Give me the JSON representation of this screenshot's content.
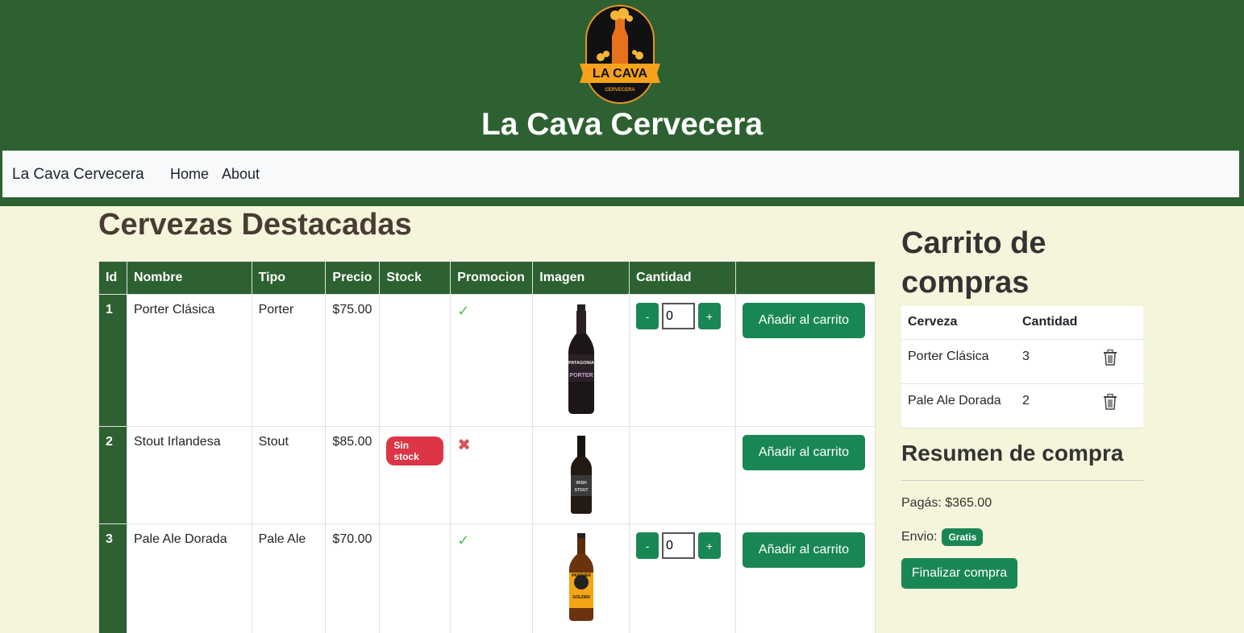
{
  "header": {
    "logo_text": "LA CAVA",
    "logo_subtext": "CERVECERA",
    "title": "La Cava Cervecera"
  },
  "navbar": {
    "brand": "La Cava Cervecera",
    "links": [
      "Home",
      "About"
    ]
  },
  "featured": {
    "title": "Cervezas Destacadas",
    "columns": [
      "Id",
      "Nombre",
      "Tipo",
      "Precio",
      "Stock",
      "Promocion",
      "Imagen",
      "Cantidad",
      ""
    ],
    "rows": [
      {
        "id": "1",
        "nombre": "Porter Clásica",
        "tipo": "Porter",
        "precio": "$75.00",
        "stock": "",
        "promocion": "✓",
        "bottle_label": "PATAGONIA",
        "bottle_label2": "PORTER",
        "cantidad": "0",
        "add_label": "Añadir al carrito"
      },
      {
        "id": "2",
        "nombre": "Stout Irlandesa",
        "tipo": "Stout",
        "precio": "$85.00",
        "stock": "Sin stock",
        "promocion": "✖",
        "bottle_label": "IRISH",
        "bottle_label2": "STOUT",
        "cantidad": "",
        "add_label": "Añadir al carrito"
      },
      {
        "id": "3",
        "nombre": "Pale Ale Dorada",
        "tipo": "Pale Ale",
        "precio": "$70.00",
        "stock": "",
        "promocion": "✓",
        "bottle_label": "PANTHER",
        "bottle_label2": "GOLDEN",
        "cantidad": "0",
        "add_label": "Añadir al carrito"
      }
    ],
    "minus_label": "-",
    "plus_label": "+"
  },
  "cart": {
    "title": "Carrito de compras",
    "columns": [
      "Cerveza",
      "Cantidad"
    ],
    "items": [
      {
        "name": "Porter Clásica",
        "qty": "3"
      },
      {
        "name": "Pale Ale Dorada",
        "qty": "2"
      }
    ]
  },
  "summary": {
    "title": "Resumen de compra",
    "pay_text": "Pagás: $365.00",
    "ship_label": "Envio:",
    "ship_badge": "Gratis",
    "finish_label": "Finalizar compra"
  },
  "colors": {
    "header_green": "#2e6131",
    "button_green": "#198754",
    "page_bg": "#f5f5dc",
    "danger": "#dc3545"
  }
}
